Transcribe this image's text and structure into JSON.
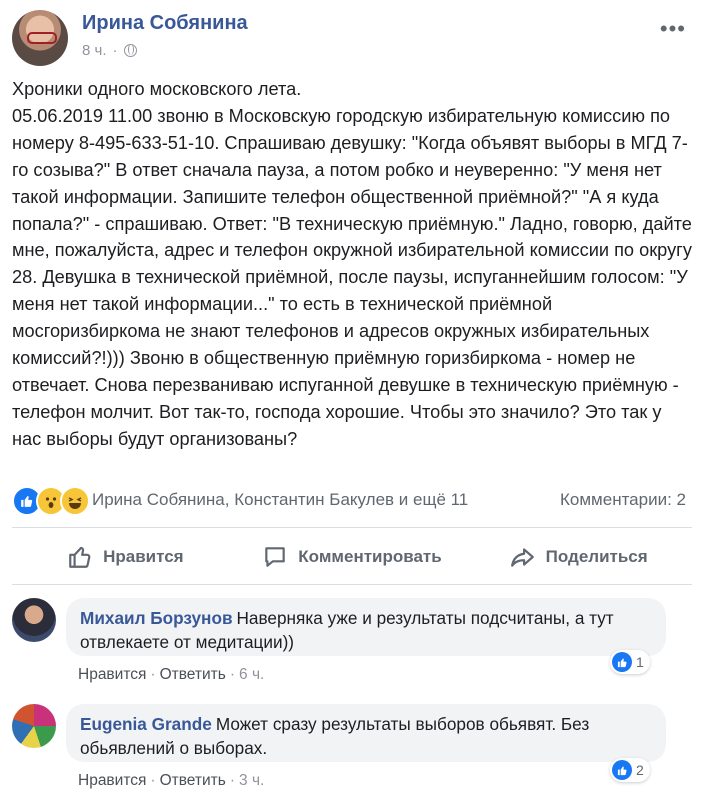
{
  "post": {
    "author": "Ирина Собянина",
    "time": "8 ч.",
    "text": "Хроники одного московского лета.\n05.06.2019 11.00 звоню в Московскую городскую избирательную комиссию по номеру 8-495-633-51-10. Спрашиваю девушку: \"Когда объявят выборы в МГД 7-го созыва?\" В ответ сначала пауза, а потом робко и неуверенно: \"У меня нет такой информации. Запишите телефон общественной приёмной?\" \"А я куда попала?\" - спрашиваю. Ответ: \"В техническую приёмную.\" Ладно, говорю, дайте мне, пожалуйста, адрес и телефон окружной избирательной комиссии по округу 28. Девушка в технической приёмной, после паузы, испуганнейшим голосом: \"У меня нет такой информации...\" то есть в технической приёмной мосгоризбиркома не знают телефонов и адресов окружных избирательных комиссий?!))) Звоню в общественную приёмную горизбиркома - номер не отвечает. Снова перезваниваю испуганной девушке в техническую приёмную - телефон молчит. Вот так-то, господа хорошие. Чтобы это значило? Это так у нас выборы будут организованы?"
  },
  "reactions": {
    "icons": [
      "like-icon",
      "wow-icon",
      "haha-icon"
    ],
    "names": "Ирина Собянина, Константин Бакулев и ещё 11",
    "comments": "Комментарии: 2"
  },
  "actions": {
    "like": "Нравится",
    "comment": "Комментировать",
    "share": "Поделиться"
  },
  "comments": [
    {
      "name": "Михаил Борзунов",
      "text": "Наверняка уже и результаты подсчитаны, а тут отвлекаете от медитации))",
      "likes": "1",
      "like_link": "Нравится",
      "reply_link": "Ответить",
      "time": "6 ч."
    },
    {
      "name": "Eugenia Grande",
      "text": "Может сразу результаты выборов обьявят. Без обьявлений о выборах.",
      "likes": "2",
      "like_link": "Нравится",
      "reply_link": "Ответить",
      "time": "3 ч."
    }
  ],
  "colors": {
    "name_link": "#385898",
    "accent": "#1877f2",
    "muted": "#606770",
    "bubble": "#f2f3f5"
  }
}
